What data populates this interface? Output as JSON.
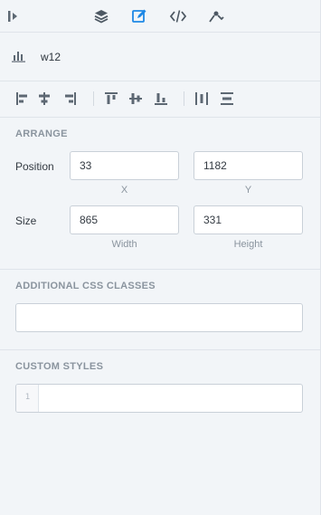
{
  "toolbar": {
    "icons": [
      "collapse-panel-icon",
      "layers-icon",
      "edit-icon",
      "code-icon",
      "connect-icon"
    ],
    "active": "edit-icon",
    "accent": "#1e88e5"
  },
  "widget": {
    "name": "w12",
    "icon": "bar-chart-icon"
  },
  "align": {
    "icons": [
      "align-left-icon",
      "align-center-horizontal-icon",
      "align-right-icon",
      "align-top-icon",
      "align-middle-vertical-icon",
      "align-bottom-icon",
      "distribute-horizontal-icon",
      "distribute-vertical-icon"
    ]
  },
  "arrange": {
    "title": "ARRANGE",
    "position_label": "Position",
    "x_value": "33",
    "y_value": "1182",
    "x_sublabel": "X",
    "y_sublabel": "Y",
    "size_label": "Size",
    "width_value": "865",
    "height_value": "331",
    "width_sublabel": "Width",
    "height_sublabel": "Height"
  },
  "css_classes": {
    "title": "ADDITIONAL CSS CLASSES",
    "value": ""
  },
  "custom_styles": {
    "title": "CUSTOM STYLES",
    "line_number": "1",
    "value": ""
  }
}
